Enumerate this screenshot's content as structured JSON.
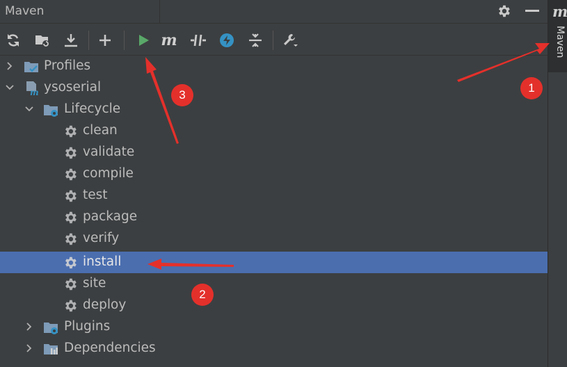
{
  "panel": {
    "title": "Maven"
  },
  "right_strip": {
    "logo": "m",
    "tab_label": "Maven"
  },
  "toolbar": {
    "buttons": [
      {
        "name": "reload-icon"
      },
      {
        "name": "add-maven-project-icon"
      },
      {
        "name": "download-sources-icon"
      },
      {
        "name": "add-icon"
      },
      {
        "name": "run-icon"
      },
      {
        "name": "execute-goal-icon",
        "glyph": "m"
      },
      {
        "name": "toggle-offline-icon"
      },
      {
        "name": "skip-tests-icon"
      },
      {
        "name": "collapse-all-icon"
      },
      {
        "name": "settings-wrench-icon"
      }
    ]
  },
  "tree": {
    "profiles": "Profiles",
    "project": "ysoserial",
    "lifecycle": "Lifecycle",
    "goals": [
      "clean",
      "validate",
      "compile",
      "test",
      "package",
      "verify",
      "install",
      "site",
      "deploy"
    ],
    "selected_goal": "install",
    "plugins": "Plugins",
    "dependencies": "Dependencies"
  },
  "annotations": {
    "badge1": "1",
    "badge2": "2",
    "badge3": "3"
  },
  "colors": {
    "background": "#3c3f41",
    "selection": "#4b6eaf",
    "run_green": "#59a869",
    "badge_red": "#e4302b",
    "folder_blue": "#5e7f9e"
  }
}
